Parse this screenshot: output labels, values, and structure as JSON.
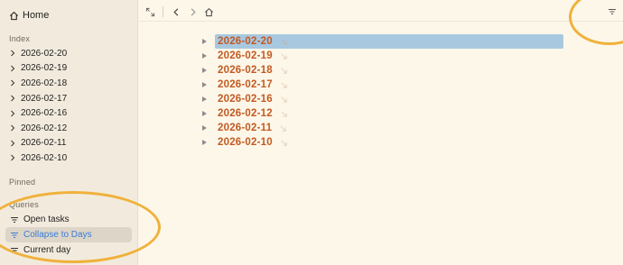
{
  "sidebar": {
    "home_label": "Home",
    "index_label": "Index",
    "index_items": [
      "2026-02-20",
      "2026-02-19",
      "2026-02-18",
      "2026-02-17",
      "2026-02-16",
      "2026-02-12",
      "2026-02-11",
      "2026-02-10"
    ],
    "pinned_label": "Pinned",
    "queries_label": "Queries",
    "queries": [
      "Open tasks",
      "Collapse to Days",
      "Current day"
    ],
    "active_query": "Collapse to Days"
  },
  "main": {
    "dates": [
      "2026-02-20",
      "2026-02-19",
      "2026-02-18",
      "2026-02-17",
      "2026-02-16",
      "2026-02-12",
      "2026-02-11",
      "2026-02-10"
    ],
    "selected_date": "2026-02-20"
  },
  "colors": {
    "background": "#fdf7e9",
    "sidebar_bg": "#f2ebdd",
    "date_text": "#c35a21",
    "selection": "#a8c8e0",
    "active_query_text": "#3a7bd5",
    "annotation_ring": "#f0b13c"
  },
  "icons": {
    "home": "home-icon",
    "expand": "expand-icon",
    "back": "chevron-left-icon",
    "forward": "chevron-right-icon",
    "nav_home": "home-icon",
    "filter": "filter-icon",
    "query": "filter-lines-icon",
    "disclosure": "chevron-right-icon",
    "open_link": "arrow-down-right-icon"
  }
}
